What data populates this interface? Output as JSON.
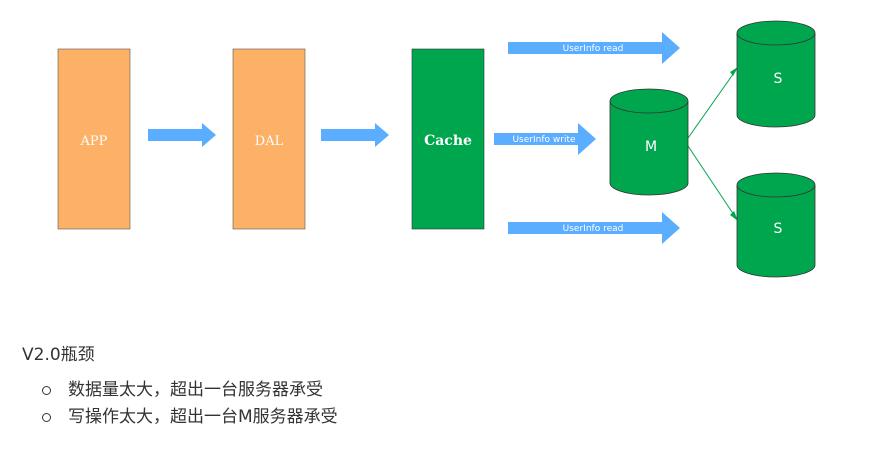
{
  "diagram": {
    "boxes": {
      "app": "APP",
      "dal": "DAL",
      "cache": "Cache"
    },
    "arrows": {
      "top": "UserInfo read",
      "mid": "UserInfo write",
      "bottom": "UserInfo read"
    },
    "databases": {
      "master": "M",
      "slave1": "S",
      "slave2": "S"
    },
    "colors": {
      "orange": "#FDB167",
      "green": "#00A64E",
      "blue_arrow": "#5BADFF",
      "line": "#00A64E"
    }
  },
  "notes": {
    "title": "V2.0瓶颈",
    "items": [
      "数据量太大，超出一台服务器承受",
      "写操作太大，超出一台M服务器承受"
    ]
  }
}
